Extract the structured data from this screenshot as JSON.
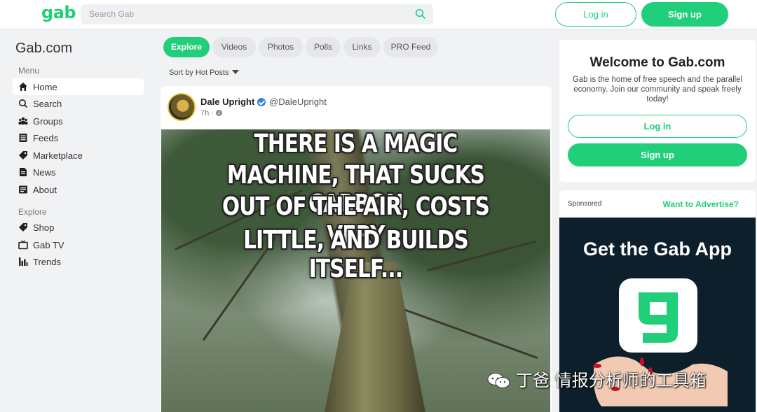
{
  "header": {
    "logo": "gab",
    "search_placeholder": "Search Gab",
    "login_label": "Log in",
    "signup_label": "Sign up"
  },
  "sidebar": {
    "site_title": "Gab.com",
    "menu_heading": "Menu",
    "menu_items": [
      {
        "label": "Home",
        "icon": "home-icon",
        "active": true
      },
      {
        "label": "Search",
        "icon": "search-icon"
      },
      {
        "label": "Groups",
        "icon": "groups-icon"
      },
      {
        "label": "Feeds",
        "icon": "feeds-icon"
      },
      {
        "label": "Marketplace",
        "icon": "tag-icon"
      },
      {
        "label": "News",
        "icon": "news-icon"
      },
      {
        "label": "About",
        "icon": "about-icon"
      }
    ],
    "explore_heading": "Explore",
    "explore_items": [
      {
        "label": "Shop",
        "icon": "tag-icon"
      },
      {
        "label": "Gab TV",
        "icon": "tv-icon"
      },
      {
        "label": "Trends",
        "icon": "trends-icon"
      }
    ]
  },
  "tabs": [
    {
      "label": "Explore",
      "active": true
    },
    {
      "label": "Videos"
    },
    {
      "label": "Photos"
    },
    {
      "label": "Polls"
    },
    {
      "label": "Links"
    },
    {
      "label": "PRO Feed"
    }
  ],
  "sort": {
    "prefix": "Sort by",
    "value": "Hot Posts"
  },
  "post": {
    "author": "Dale Upright",
    "handle": "@DaleUpright",
    "time": "7h ·",
    "meme_lines": [
      "THERE IS A MAGIC",
      "MACHINE, THAT SUCKS CARBON",
      "OUT OF THE AIR, COSTS VERY",
      "LITTLE, AND BUILDS ITSELF..."
    ]
  },
  "welcome": {
    "title": "Welcome to Gab.com",
    "description": "Gab is the home of free speech and the parallel economy. Join our community and speak freely today!",
    "login_label": "Log in",
    "signup_label": "Sign up"
  },
  "ad": {
    "sponsored_label": "Sponsored",
    "advertise_label": "Want to Advertise?",
    "title": "Get the Gab App"
  },
  "watermark": "丁爸 情报分析师的工具箱",
  "colors": {
    "brand": "#21cf7a",
    "verified": "#3a7fe0",
    "ad_bg": "#0c1f2a"
  }
}
